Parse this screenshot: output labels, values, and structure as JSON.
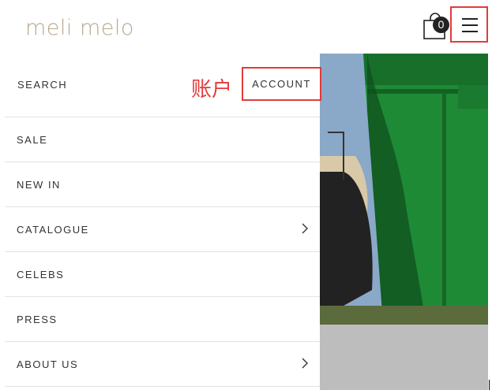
{
  "header": {
    "logo": "meli melo",
    "cart_count": "0"
  },
  "drawer": {
    "search_label": "SEARCH",
    "account_label": "ACCOUNT",
    "annotation": "账户",
    "items": [
      {
        "label": "SALE",
        "chevron": false
      },
      {
        "label": "NEW IN",
        "chevron": false
      },
      {
        "label": "CATALOGUE",
        "chevron": true
      },
      {
        "label": "CELEBS",
        "chevron": false
      },
      {
        "label": "PRESS",
        "chevron": false
      },
      {
        "label": "ABOUT US",
        "chevron": true
      }
    ]
  },
  "colors": {
    "brand_gold": "#b7a98c",
    "annotation_red": "#e23b3b",
    "hero_green": "#1f8a35"
  },
  "icons": [
    "shopping-bag-icon",
    "hamburger-menu-icon",
    "chevron-right-icon"
  ]
}
